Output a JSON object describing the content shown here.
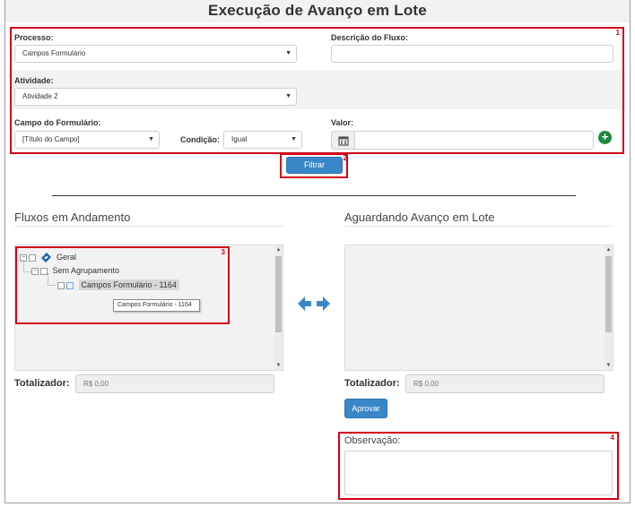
{
  "page": {
    "title": "Execução de Avanço em Lote"
  },
  "filters": {
    "processo": {
      "label": "Processo:",
      "value": "Campos Formulário"
    },
    "descricao": {
      "label": "Descrição do Fluxo:",
      "value": ""
    },
    "atividade": {
      "label": "Atividade:",
      "value": "Atividade 2"
    },
    "campo": {
      "label": "Campo do Formulário:",
      "value": "[Título do Campo]"
    },
    "condicao": {
      "label": "Condição:",
      "value": "Igual"
    },
    "valor": {
      "label": "Valor:",
      "value": ""
    },
    "filtrar_label": "Filtrar"
  },
  "callouts": [
    "1",
    "2",
    "3",
    "4"
  ],
  "left_panel": {
    "title": "Fluxos em Andamento",
    "tree": [
      {
        "label": "Geral"
      },
      {
        "label": "Sem Agrupamento"
      },
      {
        "label": "Campos Formulário - 1164"
      }
    ],
    "tooltip": "Campos Formulário - 1164",
    "totalizador_label": "Totalizador:",
    "totalizador_value": "R$ 0,00"
  },
  "right_panel": {
    "title": "Aguardando Avanço em Lote",
    "totalizador_label": "Totalizador:",
    "totalizador_value": "R$ 0,00",
    "aprovar_label": "Aprovar",
    "observacao_label": "Observação:",
    "observacao_value": ""
  },
  "colors": {
    "accent": "#3a87c8",
    "callout": "#d0021b",
    "add_green": "#1f8a3b",
    "brand_logo": "#1e63b5"
  },
  "icons": {
    "swap": "swap-arrows-icon",
    "calendar": "calendar-icon",
    "add": "plus-circle-icon",
    "logo": "geral-logo-icon"
  }
}
